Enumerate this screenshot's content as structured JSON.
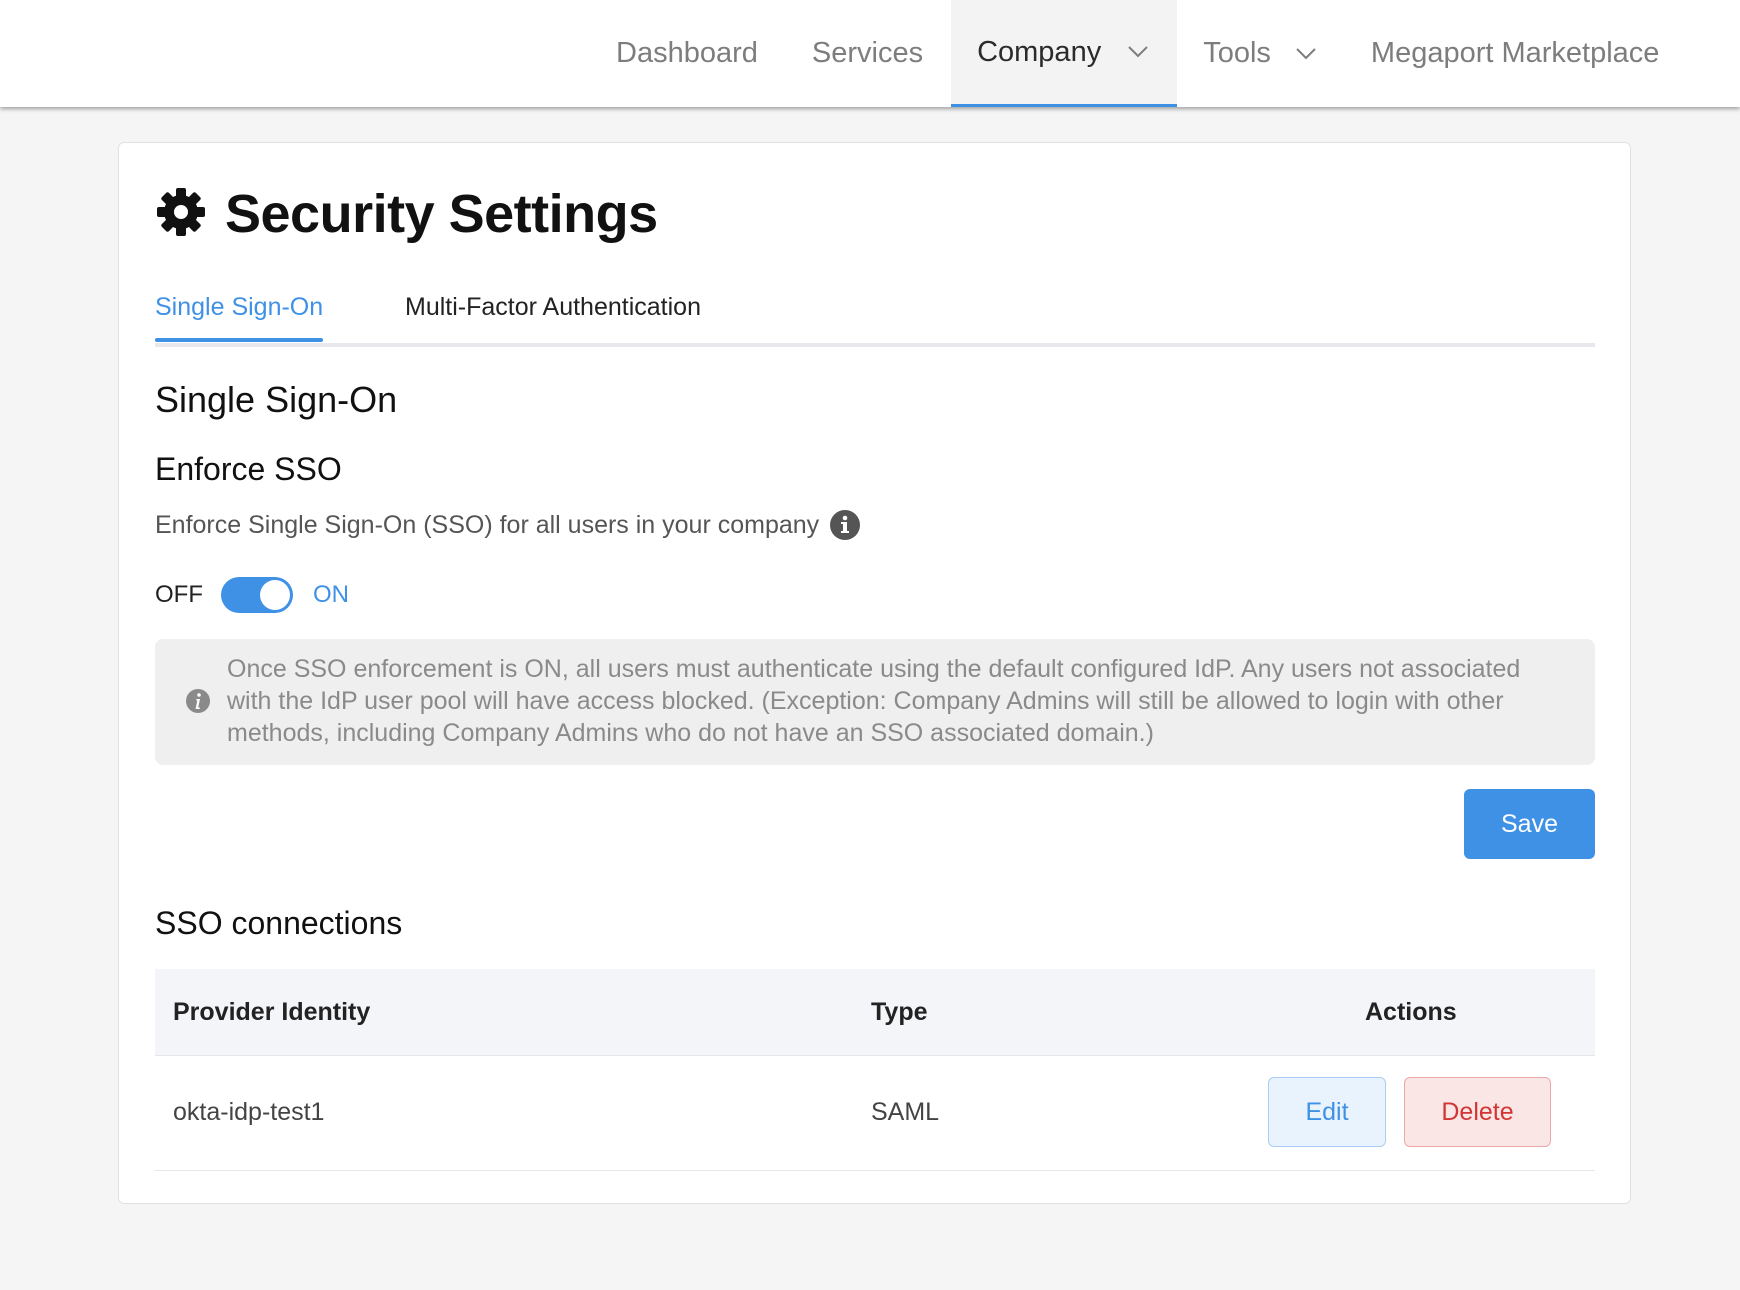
{
  "nav": {
    "items": [
      {
        "label": "Dashboard"
      },
      {
        "label": "Services"
      },
      {
        "label": "Company"
      },
      {
        "label": "Tools"
      },
      {
        "label": "Megaport Marketplace"
      }
    ]
  },
  "page": {
    "title": "Security Settings",
    "icon": "gear-icon"
  },
  "tabs": [
    {
      "label": "Single Sign-On",
      "active": true
    },
    {
      "label": "Multi-Factor Authentication",
      "active": false
    }
  ],
  "sso": {
    "heading": "Single Sign-On",
    "enforce_title": "Enforce SSO",
    "enforce_description": "Enforce Single Sign-On (SSO) for all users in your company",
    "toggle_off_label": "OFF",
    "toggle_on_label": "ON",
    "toggle_state": "on",
    "notice": "Once SSO enforcement is ON, all users must authenticate using the default configured IdP. Any users not associated with the IdP user pool will have access blocked. (Exception: Company Admins will still be allowed to login with other methods, including Company Admins who do not have an SSO associated domain.)",
    "save_label": "Save"
  },
  "connections": {
    "heading": "SSO connections",
    "columns": {
      "provider": "Provider Identity",
      "type": "Type",
      "actions": "Actions"
    },
    "rows": [
      {
        "provider": "okta-idp-test1",
        "type": "SAML",
        "edit_label": "Edit",
        "delete_label": "Delete"
      }
    ]
  },
  "colors": {
    "accent": "#3f91e6",
    "danger": "#d23535",
    "danger_bg": "#fbe6e6",
    "edit_bg": "#e8f3fd"
  }
}
